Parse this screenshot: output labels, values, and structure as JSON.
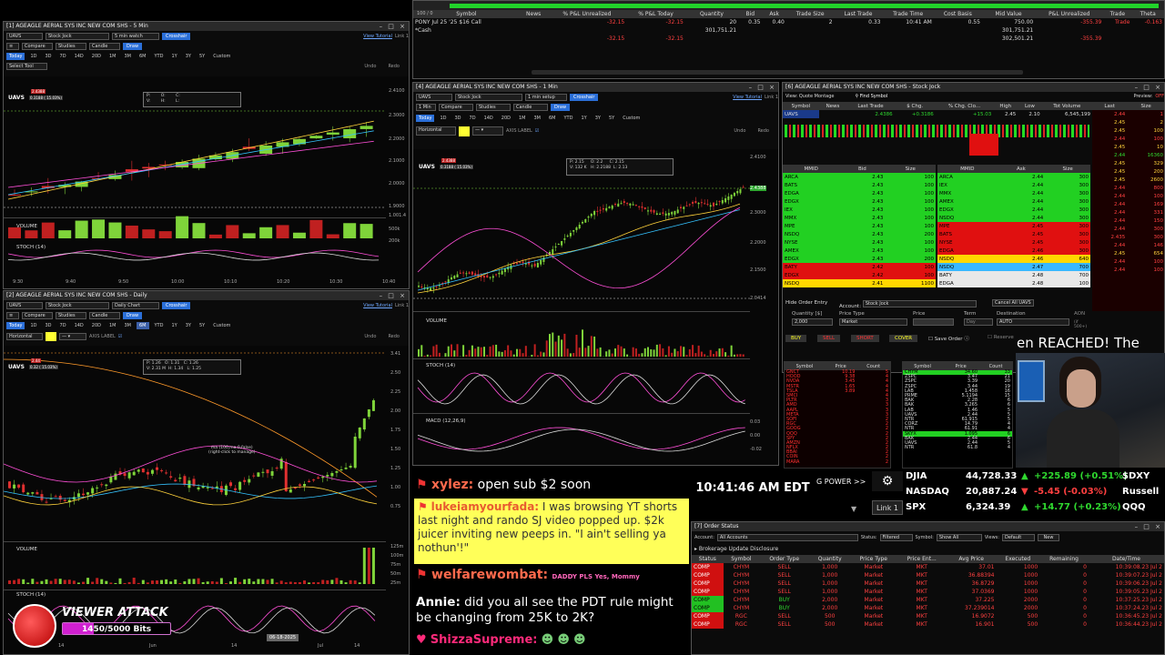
{
  "win1": {
    "title": "[1] AGEAGLE AERIAL SYS INC NEW COM SHS - 5 Min",
    "symbol": "UAVS",
    "layout": "Stock Jock",
    "interval": "5 min watch",
    "crosshair": "Crosshair",
    "view_tutorial": "View Tutorial",
    "link": "Link 1",
    "menu": [
      "Compare",
      "Studies",
      "Candle"
    ],
    "draw": "Draw",
    "ranges": [
      "Today",
      "1D",
      "3D",
      "7D",
      "14D",
      "20D",
      "1M",
      "3M",
      "6M",
      "YTD",
      "1Y",
      "3Y",
      "5Y",
      "Custom"
    ],
    "select_tool": "Select Tool",
    "undo": "Undo",
    "redo": "Redo",
    "sym_label": "UAVS",
    "price_tag": "2.4388",
    "chg_label": "0.3188 ( 15.03%)",
    "ohlc": [
      "P:",
      "O:",
      "C:",
      "V:",
      "H:",
      "L:"
    ],
    "volume_label": "VOLUME",
    "stoch_label": "STOCH (14)",
    "price_ticks": [
      "2.4100",
      "2.3000",
      "2.2000",
      "2.1000",
      "2.0000",
      "1.9000"
    ],
    "vol_ticks": [
      "1.001.4",
      "500k",
      "200k"
    ],
    "time_ticks": [
      "9:30",
      "9:40",
      "9:50",
      "10:00",
      "10:10",
      "10:20",
      "10:30",
      "10:40"
    ]
  },
  "win2": {
    "title": "[2] AGEAGLE AERIAL SYS INC NEW COM SHS - Daily",
    "symbol": "UAVS",
    "layout": "Stock Jock",
    "interval": "Daily Chart",
    "crosshair": "Crosshair",
    "view_tutorial": "View Tutorial",
    "link": "Link 1",
    "menu": [
      "Compare",
      "Studies",
      "Candle"
    ],
    "draw": "Draw",
    "ranges": [
      "Today",
      "1D",
      "3D",
      "7D",
      "14D",
      "20D",
      "1M",
      "3M",
      "6M",
      "YTD",
      "1Y",
      "3Y",
      "5Y",
      "Custom"
    ],
    "horizontal": "Horizontal",
    "axis_label": "AXIS LABEL",
    "undo": "Undo",
    "redo": "Redo",
    "sym_label": "UAVS",
    "price_tag": "2.44",
    "chg_label": "0.32 ( 15.03%)",
    "ohlc": [
      "P: 1.26",
      "O: 1.31",
      "C: 1.26",
      "V: 2.31 M",
      "H: 1.34",
      "L: 1.25"
    ],
    "ma_note": "ma (100,ma,0,false)",
    "ma_note2": "(right-click to manage)",
    "volume_label": "VOLUME",
    "stoch_label": "STOCH (14)",
    "price_ticks": [
      "3.41",
      "2.50",
      "2.25",
      "2.00",
      "1.75",
      "1.50",
      "1.25",
      "1.00",
      "0.75"
    ],
    "vol_ticks": [
      "125m",
      "100m",
      "75m",
      "50m",
      "25m"
    ],
    "time_ticks": [
      "14",
      "Jun",
      "14",
      "Jul",
      "14"
    ],
    "date_badge": "06-18-2025"
  },
  "positions": {
    "header": [
      "Symbol",
      "News",
      "% P&L Unrealized",
      "% P&L Today",
      "Quantity",
      "Bid",
      "Ask",
      "Trade Size",
      "Last Trade",
      "Trade Time",
      "Cost Basis",
      "Mid Value",
      "P&L Unrealized",
      "Trade",
      "Theta"
    ],
    "rows": [
      [
        "PONY Jul 25 '25 $16 Call",
        "",
        "-32.15",
        "-32.15",
        "20",
        "0.35",
        "0.40",
        "2",
        "0.33",
        "10:41 AM",
        "0.55",
        "750.00",
        "-355.39",
        "Trade",
        "-0.163"
      ],
      [
        "*Cash",
        "",
        "",
        "",
        "301,751.21",
        "",
        "",
        "",
        "",
        "",
        "",
        "301,751.21",
        "",
        "",
        ""
      ],
      [
        "",
        "",
        "-32.15",
        "-32.15",
        "",
        "",
        "",
        "",
        "",
        "",
        "",
        "302,501.21",
        "-355.39",
        "",
        ""
      ]
    ],
    "top_label": "100 / 0"
  },
  "win4": {
    "title": "[4] AGEAGLE AERIAL SYS INC NEW COM SHS - 1 Min",
    "symbol": "UAVS",
    "layout": "Stock Jock",
    "interval": "1 min setup",
    "crosshair": "Crosshair",
    "view_tutorial": "View Tutorial",
    "link": "Link 1",
    "period": "1 Min",
    "menu": [
      "Compare",
      "Studies",
      "Candle"
    ],
    "draw": "Draw",
    "ranges": [
      "Today",
      "1D",
      "3D",
      "7D",
      "14D",
      "20D",
      "1M",
      "3M",
      "6M",
      "YTD",
      "1Y",
      "3Y",
      "5Y",
      "Custom"
    ],
    "horizontal": "Horizontal",
    "axis_label": "AXIS LABEL",
    "undo": "Undo",
    "redo": "Redo",
    "sym_label": "UAVS",
    "price_tag": "2.4388",
    "chg_label": "0.3188 ( 15.03%)",
    "ohlc": [
      "P: 2.15",
      "O: 2.2",
      "C: 2.15",
      "V: 132 K",
      "H: 2.2188",
      "L: 2.13"
    ],
    "volume_label": "VOLUME",
    "stoch_label": "STOCH (14)",
    "macd_label": "MACD (12,26,9)",
    "price_ticks": [
      "2.4100",
      "2.4388",
      "2.3000",
      "2.2000",
      "2.1500",
      "2.0414"
    ],
    "macd_ticks": [
      "0.03",
      "0.00",
      "-0.02"
    ]
  },
  "l2": {
    "title": "[6] AGEAGLE AERIAL SYS INC NEW COM SHS - Stock Jock",
    "view": "View: Quote Montage",
    "find": "Find Symbol",
    "preview": "Preview:",
    "preview_state": "OFF",
    "quote_header": [
      "Symbol",
      "News",
      "Last Trade",
      "$ Chg.",
      "% Chg. Clo...",
      "High",
      "Low",
      "Tot Volume"
    ],
    "quote": [
      "UAVS",
      "",
      "2.4386",
      "+0.3186",
      "+15.03",
      "2.45",
      "2.10",
      "6,545,199"
    ],
    "bid_header": [
      "MMID",
      "Bid",
      "Size"
    ],
    "ask_header": [
      "MMID",
      "Ask",
      "Size"
    ],
    "bids": [
      [
        "ARCA",
        "2.43",
        "100"
      ],
      [
        "BATS",
        "2.43",
        "100"
      ],
      [
        "EDGA",
        "2.43",
        "100"
      ],
      [
        "EDGX",
        "2.43",
        "100"
      ],
      [
        "IEX",
        "2.43",
        "100"
      ],
      [
        "MMX",
        "2.43",
        "100"
      ],
      [
        "MPE",
        "2.43",
        "100"
      ],
      [
        "NSDQ",
        "2.43",
        "200"
      ],
      [
        "NYSE",
        "2.43",
        "100"
      ],
      [
        "AMEX",
        "2.43",
        "100"
      ],
      [
        "EDGX",
        "2.43",
        "200"
      ],
      [
        "BATY",
        "2.42",
        "100"
      ],
      [
        "EDGX",
        "2.42",
        "100"
      ],
      [
        "NSDQ",
        "2.41",
        "1100"
      ]
    ],
    "asks": [
      [
        "ARCA",
        "2.44",
        "300"
      ],
      [
        "IEX",
        "2.44",
        "300"
      ],
      [
        "MMX",
        "2.44",
        "300"
      ],
      [
        "AMEX",
        "2.44",
        "300"
      ],
      [
        "EDGX",
        "2.44",
        "300"
      ],
      [
        "NSDQ",
        "2.44",
        "300"
      ],
      [
        "MPE",
        "2.45",
        "300"
      ],
      [
        "BATS",
        "2.45",
        "300"
      ],
      [
        "NYSE",
        "2.45",
        "300"
      ],
      [
        "EDGA",
        "2.46",
        "300"
      ],
      [
        "NSDQ",
        "2.46",
        "640"
      ],
      [
        "NSDQ",
        "2.47",
        "700"
      ],
      [
        "BATY",
        "2.48",
        "700"
      ],
      [
        "EDGA",
        "2.48",
        "100"
      ]
    ],
    "ts_header": [
      "Last",
      "Size"
    ],
    "ts": [
      [
        "2.44",
        "1"
      ],
      [
        "2.45",
        "2"
      ],
      [
        "2.45",
        "100"
      ],
      [
        "2.44",
        "100"
      ],
      [
        "2.45",
        "10"
      ],
      [
        "2.44",
        "16360"
      ],
      [
        "2.45",
        "329"
      ],
      [
        "2.45",
        "200"
      ],
      [
        "2.45",
        "2600"
      ],
      [
        "2.44",
        "800"
      ],
      [
        "2.44",
        "100"
      ],
      [
        "2.44",
        "169"
      ],
      [
        "2.44",
        "331"
      ],
      [
        "2.44",
        "150"
      ],
      [
        "2.44",
        "300"
      ],
      [
        "2.435",
        "300"
      ],
      [
        "2.44",
        "146"
      ],
      [
        "2.45",
        "654"
      ],
      [
        "2.44",
        "100"
      ],
      [
        "2.44",
        "100"
      ]
    ],
    "hide_order": "Hide Order Entry",
    "account_lbl": "Account:",
    "account": "Stock Jock",
    "cancel_all": "Cancel All UAVS",
    "qty_lbl": "Quantity",
    "qty_unit": "[$]",
    "qty": "2,000",
    "ptype_lbl": "Price Type",
    "ptype": "Market",
    "price_lbl": "Price",
    "term_lbl": "Term",
    "term": "Day",
    "dest_lbl": "Destination",
    "dest": "AUTO",
    "aon": "AON",
    "buy": "BUY",
    "sell": "SELL",
    "short": "SHORT",
    "cover": "COVER",
    "save_order": "Save Order",
    "reserve": "Reserve",
    "of500": "(if 500+)",
    "hot_header": [
      "Symbol",
      "Price",
      "Count"
    ],
    "hot_left": [
      [
        "GNCT",
        "10.19",
        "5"
      ],
      [
        "HOOD",
        "9.38",
        "4"
      ],
      [
        "NVDA",
        "3.45",
        "4"
      ],
      [
        "MSTR",
        "1.65",
        "4"
      ],
      [
        "TSLA",
        "3.89",
        "4"
      ],
      [
        "SMCI",
        "",
        "4"
      ],
      [
        "PLTR",
        "",
        "3"
      ],
      [
        "AMD",
        "",
        "3"
      ],
      [
        "AAPL",
        "",
        "3"
      ],
      [
        "META",
        "",
        "3"
      ],
      [
        "SOFI",
        "",
        "2"
      ],
      [
        "RGC",
        "",
        "2"
      ],
      [
        "GOOG",
        "",
        "2"
      ],
      [
        "QQQ",
        "",
        "2"
      ],
      [
        "SPY",
        "",
        "2"
      ],
      [
        "AMZN",
        "",
        "2"
      ],
      [
        "NFLX",
        "",
        "2"
      ],
      [
        "BBAI",
        "",
        "2"
      ],
      [
        "COIN",
        "",
        "2"
      ],
      [
        "MARA",
        "",
        "2"
      ]
    ],
    "hot_right": [
      [
        "CHYM",
        "34.60",
        "33"
      ],
      [
        "ZSPC",
        "3.47",
        "21"
      ],
      [
        "ZSPC",
        "3.39",
        "20"
      ],
      [
        "ZSPC",
        "3.44",
        "19"
      ],
      [
        "LAB",
        "1.458",
        "16"
      ],
      [
        "PRME",
        "5.1194",
        "15"
      ],
      [
        "BAK",
        "2.28",
        "6"
      ],
      [
        "BAK",
        "3.265",
        "6"
      ],
      [
        "LAB",
        "1.46",
        "5"
      ],
      [
        "UAVS",
        "2.44",
        "5"
      ],
      [
        "NTR",
        "61.915",
        "5"
      ],
      [
        "CORZ",
        "14.79",
        "4"
      ],
      [
        "NTR",
        "61.91",
        "4"
      ],
      [
        "SKYX",
        "1.095",
        "6"
      ],
      [
        "BAK",
        "2.44",
        "6"
      ],
      [
        "UAVS",
        "2.44",
        "5"
      ],
      [
        "NTR",
        "61.8",
        "4"
      ]
    ]
  },
  "overlay": {
    "alert_text": "en REACHED!  The",
    "clock": "10:41:46 AM EDT",
    "buying_power": "G POWER >>",
    "link": "Link 1",
    "indices": [
      {
        "name": "DJIA",
        "value": "44,728.33",
        "dir": "up",
        "chg": "+225.89 (+0.51%)",
        "tag": "$DXY"
      },
      {
        "name": "NASDAQ",
        "value": "20,887.24",
        "dir": "dn",
        "chg": "-5.45 (-0.03%)",
        "tag": "Russell"
      },
      {
        "name": "SPX",
        "value": "6,324.39",
        "dir": "up",
        "chg": "+14.77 (+0.23%)",
        "tag": "QQQ"
      }
    ]
  },
  "chat": [
    {
      "user": "xylez:",
      "text": "open sub $2 soon",
      "user_color": "#ff6a4d"
    },
    {
      "user": "lukeiamyourfada:",
      "text": "I was browsing YT shorts last night and rando SJ video popped up. $2k juicer inviting new peeps in. \"I ain't selling ya nothun'!\"",
      "user_color": "#c0392b",
      "highlight": true
    },
    {
      "user": "welfarewombat:",
      "text": "",
      "user_color": "#ff6a4d",
      "emote": "DADDY PLS Yes, Mommy"
    },
    {
      "user": "Annie:",
      "text": "did you all see the PDT rule might be changing from 25K to 2K?",
      "user_color": "#ffffff"
    },
    {
      "user": "ShizzaSupreme:",
      "text": "",
      "user_color": "#ff2a7a"
    }
  ],
  "viewer_attack": {
    "label": "VIEWER ATTACK",
    "progress_text": "1450/5000 Bits",
    "progress": 0.29
  },
  "orders": {
    "title": "[7] Order Status",
    "account_lbl": "Account:",
    "account": "All Accounts",
    "status_lbl": "Status:",
    "status": "Filtered",
    "symbol_lbl": "Symbol:",
    "symbol": "Show All",
    "views_lbl": "Views:",
    "views": "Default",
    "new_btn": "New",
    "disclosure": "Brokerage Update Disclosure",
    "header": [
      "Status",
      "Symbol",
      "Order Type",
      "Quantity",
      "Price Type",
      "Price Ent...",
      "Avg Price",
      "Executed",
      "Remaining",
      "Date/Time"
    ],
    "rows": [
      [
        "COMP",
        "CHYM",
        "SELL",
        "1,000",
        "Market",
        "MKT",
        "37.01",
        "1000",
        "0",
        "10:39:08.23 Jul 2"
      ],
      [
        "COMP",
        "CHYM",
        "SELL",
        "1,000",
        "Market",
        "MKT",
        "36.88394",
        "1000",
        "0",
        "10:39:07.23 Jul 2"
      ],
      [
        "COMP",
        "CHYM",
        "SELL",
        "1,000",
        "Market",
        "MKT",
        "36.8729",
        "1000",
        "0",
        "10:39:06.23 Jul 2"
      ],
      [
        "COMP",
        "CHYM",
        "SELL",
        "1,000",
        "Market",
        "MKT",
        "37.0369",
        "1000",
        "0",
        "10:39:05.23 Jul 2"
      ],
      [
        "COMP",
        "CHYM",
        "BUY",
        "2,000",
        "Market",
        "MKT",
        "37.225",
        "2000",
        "0",
        "10:37:25.23 Jul 2"
      ],
      [
        "COMP",
        "CHYM",
        "BUY",
        "2,000",
        "Market",
        "MKT",
        "37.239014",
        "2000",
        "0",
        "10:37:24.23 Jul 2"
      ],
      [
        "COMP",
        "RGC",
        "SELL",
        "500",
        "Market",
        "MKT",
        "16.9072",
        "500",
        "0",
        "10:36:45.23 Jul 2"
      ],
      [
        "COMP",
        "RGC",
        "SELL",
        "500",
        "Market",
        "MKT",
        "16.901",
        "500",
        "0",
        "10:36:44.23 Jul 2"
      ]
    ]
  }
}
